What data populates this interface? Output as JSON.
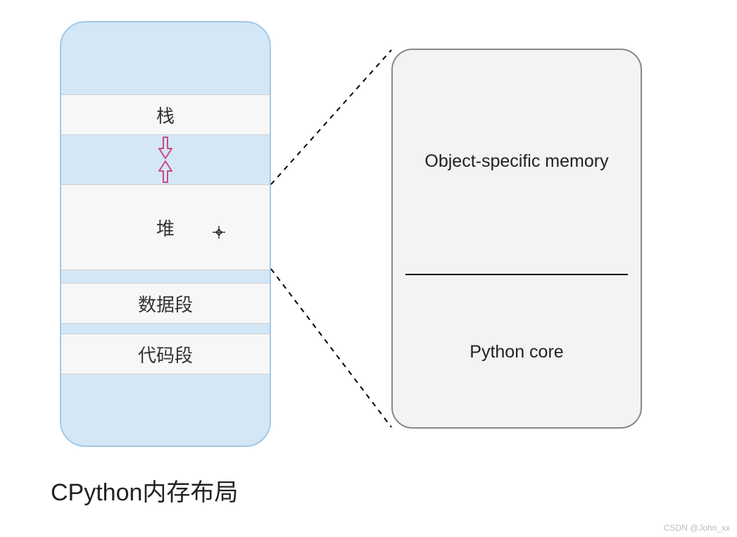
{
  "caption": "CPython内存布局",
  "watermark": "CSDN @John_xx",
  "memory": {
    "stack": "栈",
    "heap": "堆",
    "data": "数据段",
    "code": "代码段"
  },
  "detail": {
    "top": "Object-specific memory",
    "bottom": "Python core"
  }
}
